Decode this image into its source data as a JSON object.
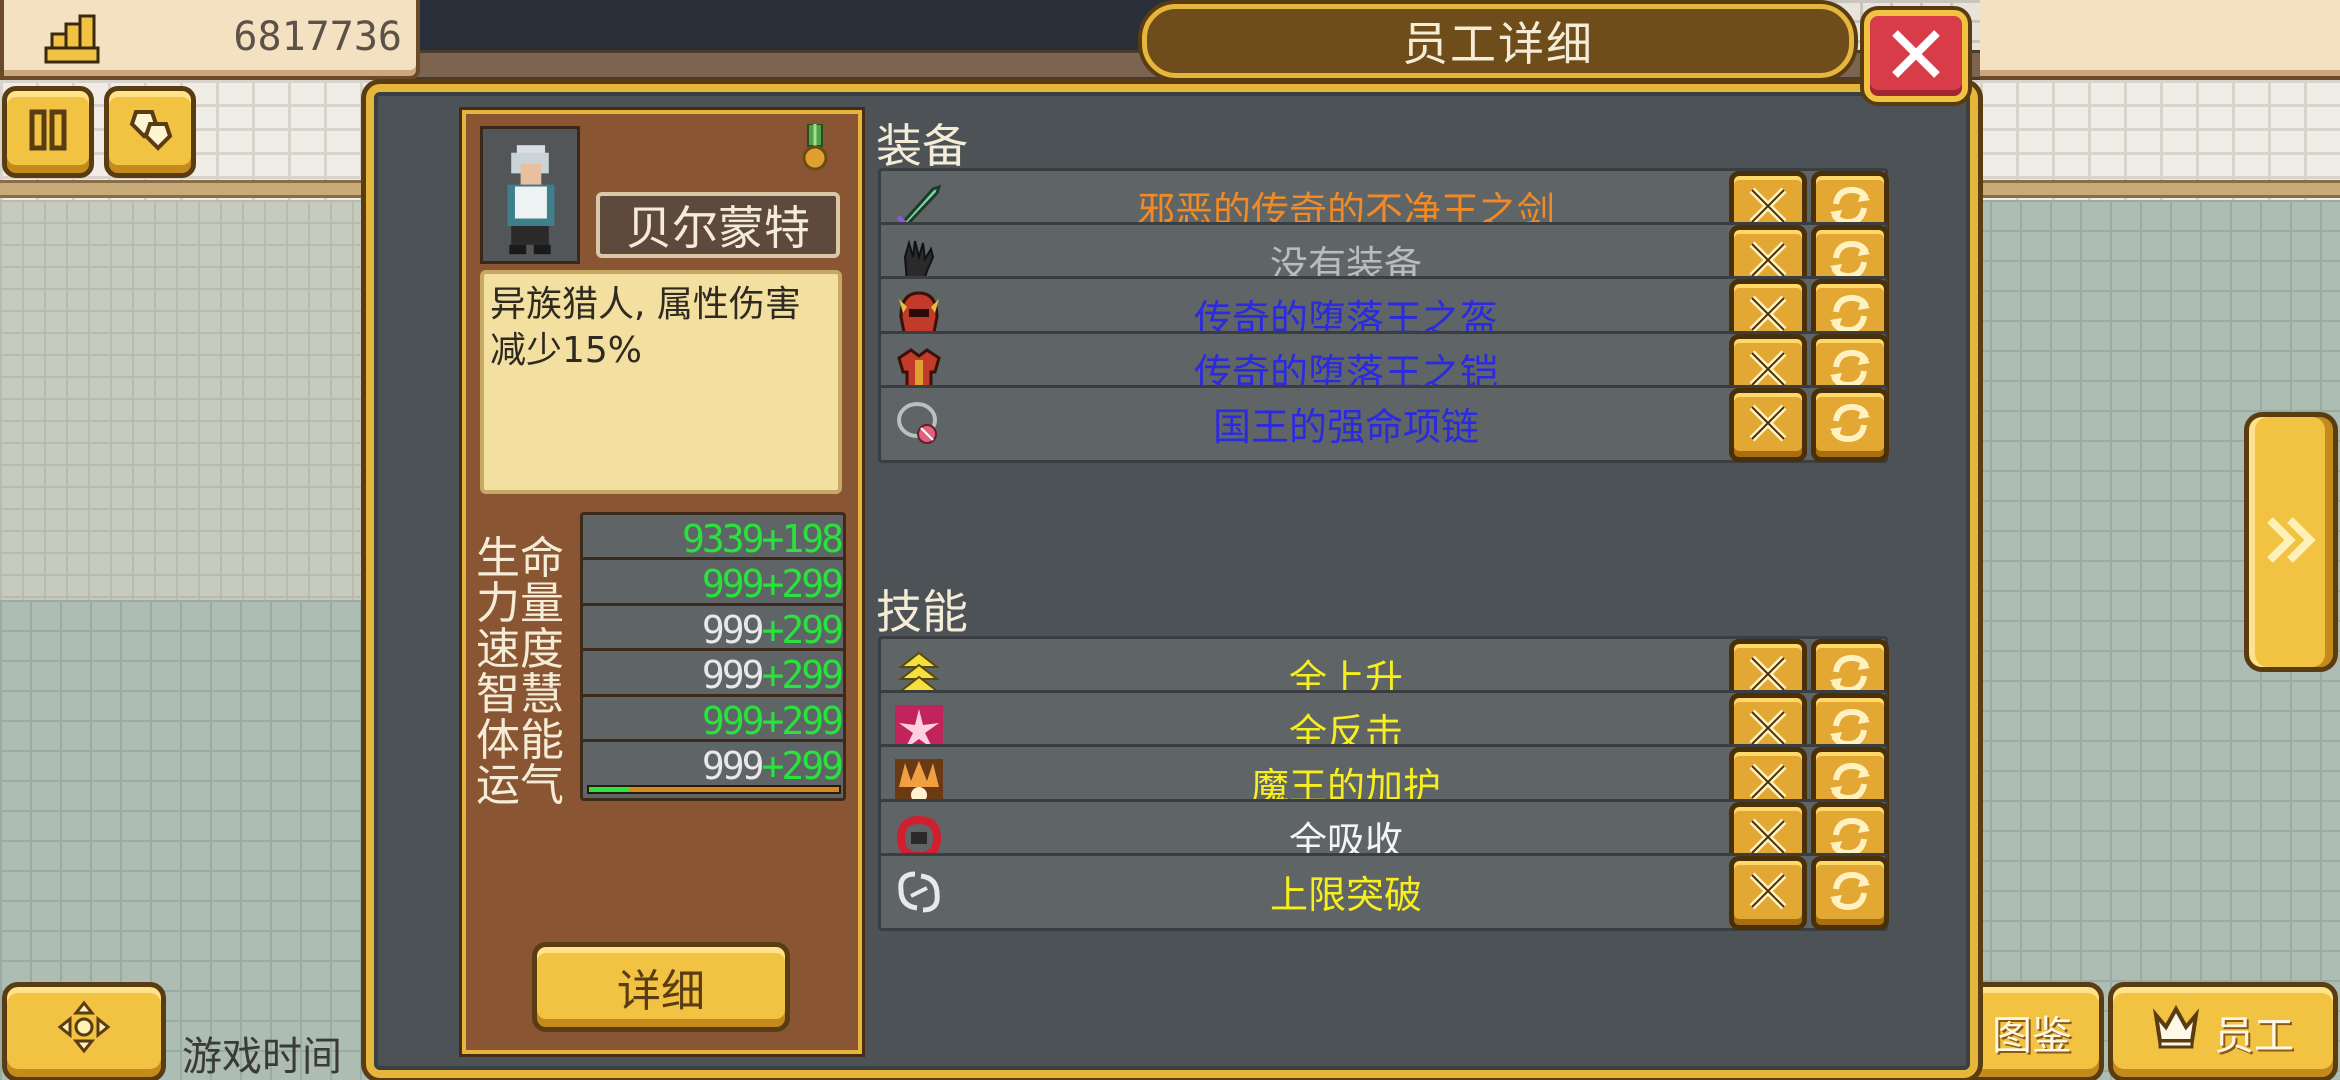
{
  "top_bar": {
    "money_value": "6817736",
    "money_icon": "gold-bars-icon"
  },
  "buttons": {
    "pause_icon": "pause-icon",
    "gems_icon": "gems-icon",
    "move_icon": "move-icon"
  },
  "game_time_label": "游戏时间",
  "bottom_right": {
    "encyclopedia_label": "图鉴",
    "staff_label": "员工",
    "staff_icon": "crown-icon"
  },
  "dialog": {
    "title": "员工详细",
    "close_icon": "close-icon"
  },
  "character": {
    "name": "贝尔蒙特",
    "description": "异族猎人, 属性伤害减少15%",
    "medal_icon": "medal-icon",
    "stats": [
      {
        "label": "生命",
        "base": "9339",
        "bonus": "+198",
        "fill": 0.05,
        "all_green": true
      },
      {
        "label": "力量",
        "base": "999",
        "bonus": "+299",
        "fill": 0.0,
        "all_green": true
      },
      {
        "label": "速度",
        "base": "999",
        "bonus": "+299",
        "fill": 0.16,
        "all_green": false
      },
      {
        "label": "智慧",
        "base": "999",
        "bonus": "+299",
        "fill": 0.0,
        "all_green": false
      },
      {
        "label": "体能",
        "base": "999",
        "bonus": "+299",
        "fill": 0.0,
        "all_green": true
      },
      {
        "label": "运气",
        "base": "999",
        "bonus": "+299",
        "fill": 0.16,
        "all_green": false
      }
    ],
    "detail_button_label": "详细"
  },
  "equipment": {
    "section_title": "装备",
    "items": [
      {
        "name": "邪恶的传奇的不净王之剑",
        "color": "#f08a24",
        "icon": "sword-icon"
      },
      {
        "name": "没有装备",
        "color": "#b9bcbc",
        "icon": "glove-icon"
      },
      {
        "name": "传奇的堕落王之盔",
        "color": "#2a2ae0",
        "icon": "helmet-icon"
      },
      {
        "name": "传奇的堕落王之铠",
        "color": "#2a2ae0",
        "icon": "armor-icon"
      },
      {
        "name": "国王的强命项链",
        "color": "#2a2ae0",
        "icon": "necklace-icon"
      }
    ]
  },
  "skills": {
    "section_title": "技能",
    "items": [
      {
        "name": "全上升",
        "color": "#f6ee1e",
        "icon": "rise-icon"
      },
      {
        "name": "全反击",
        "color": "#f6ee1e",
        "icon": "counter-icon"
      },
      {
        "name": "魔王的加护",
        "color": "#f6ee1e",
        "icon": "demon-king-icon"
      },
      {
        "name": "全吸收",
        "color": "#f4f4f4",
        "icon": "absorb-icon"
      },
      {
        "name": "上限突破",
        "color": "#f6ee1e",
        "icon": "limit-break-icon"
      }
    ]
  },
  "colors": {
    "dialog_bg": "#4c5255",
    "gold_frame": "#e6b53c",
    "button_gold": "#f2c243",
    "close_red": "#d93c49",
    "stat_green": "#27e33b"
  }
}
